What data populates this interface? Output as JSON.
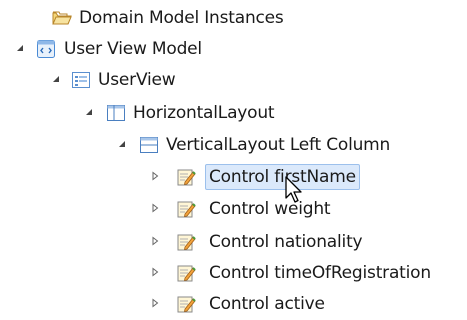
{
  "tree": {
    "domain_model_instances": {
      "label": "Domain Model Instances",
      "icon": "folder-icon"
    },
    "user_view_model": {
      "label": "User View Model",
      "icon": "view-model-icon",
      "expanded": true
    },
    "user_view": {
      "label": "UserView",
      "icon": "view-icon",
      "expanded": true
    },
    "horizontal_layout": {
      "label": "HorizontalLayout",
      "icon": "horizontal-layout-icon",
      "expanded": true
    },
    "vertical_layout": {
      "label": "VerticalLayout Left Column",
      "icon": "vertical-layout-icon",
      "expanded": true
    },
    "controls": [
      {
        "label": "Control firstName",
        "icon": "control-icon",
        "expanded": false,
        "selected": true
      },
      {
        "label": "Control weight",
        "icon": "control-icon",
        "expanded": false,
        "selected": false
      },
      {
        "label": "Control nationality",
        "icon": "control-icon",
        "expanded": false,
        "selected": false
      },
      {
        "label": "Control timeOfRegistration",
        "icon": "control-icon",
        "expanded": false,
        "selected": false
      },
      {
        "label": "Control active",
        "icon": "control-icon",
        "expanded": false,
        "selected": false
      }
    ]
  },
  "colors": {
    "selection_bg": "#dbe9fb",
    "selection_border": "#9cc0ec",
    "folder": "#e9b949",
    "view_icon": "#4a90d9"
  }
}
